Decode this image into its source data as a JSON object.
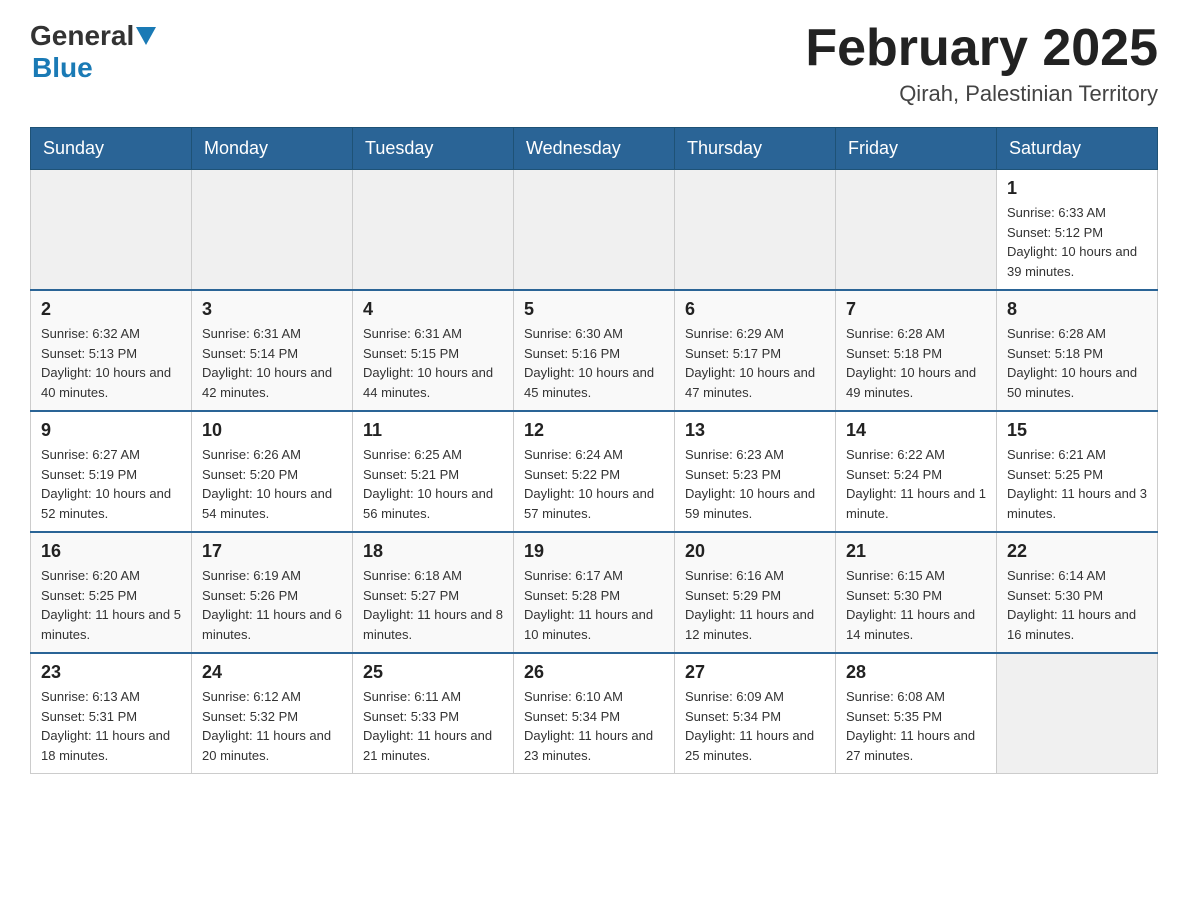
{
  "header": {
    "logo_general": "General",
    "logo_blue": "Blue",
    "month_title": "February 2025",
    "location": "Qirah, Palestinian Territory"
  },
  "days_of_week": [
    "Sunday",
    "Monday",
    "Tuesday",
    "Wednesday",
    "Thursday",
    "Friday",
    "Saturday"
  ],
  "weeks": [
    [
      {
        "date": "",
        "info": ""
      },
      {
        "date": "",
        "info": ""
      },
      {
        "date": "",
        "info": ""
      },
      {
        "date": "",
        "info": ""
      },
      {
        "date": "",
        "info": ""
      },
      {
        "date": "",
        "info": ""
      },
      {
        "date": "1",
        "info": "Sunrise: 6:33 AM\nSunset: 5:12 PM\nDaylight: 10 hours and 39 minutes."
      }
    ],
    [
      {
        "date": "2",
        "info": "Sunrise: 6:32 AM\nSunset: 5:13 PM\nDaylight: 10 hours and 40 minutes."
      },
      {
        "date": "3",
        "info": "Sunrise: 6:31 AM\nSunset: 5:14 PM\nDaylight: 10 hours and 42 minutes."
      },
      {
        "date": "4",
        "info": "Sunrise: 6:31 AM\nSunset: 5:15 PM\nDaylight: 10 hours and 44 minutes."
      },
      {
        "date": "5",
        "info": "Sunrise: 6:30 AM\nSunset: 5:16 PM\nDaylight: 10 hours and 45 minutes."
      },
      {
        "date": "6",
        "info": "Sunrise: 6:29 AM\nSunset: 5:17 PM\nDaylight: 10 hours and 47 minutes."
      },
      {
        "date": "7",
        "info": "Sunrise: 6:28 AM\nSunset: 5:18 PM\nDaylight: 10 hours and 49 minutes."
      },
      {
        "date": "8",
        "info": "Sunrise: 6:28 AM\nSunset: 5:18 PM\nDaylight: 10 hours and 50 minutes."
      }
    ],
    [
      {
        "date": "9",
        "info": "Sunrise: 6:27 AM\nSunset: 5:19 PM\nDaylight: 10 hours and 52 minutes."
      },
      {
        "date": "10",
        "info": "Sunrise: 6:26 AM\nSunset: 5:20 PM\nDaylight: 10 hours and 54 minutes."
      },
      {
        "date": "11",
        "info": "Sunrise: 6:25 AM\nSunset: 5:21 PM\nDaylight: 10 hours and 56 minutes."
      },
      {
        "date": "12",
        "info": "Sunrise: 6:24 AM\nSunset: 5:22 PM\nDaylight: 10 hours and 57 minutes."
      },
      {
        "date": "13",
        "info": "Sunrise: 6:23 AM\nSunset: 5:23 PM\nDaylight: 10 hours and 59 minutes."
      },
      {
        "date": "14",
        "info": "Sunrise: 6:22 AM\nSunset: 5:24 PM\nDaylight: 11 hours and 1 minute."
      },
      {
        "date": "15",
        "info": "Sunrise: 6:21 AM\nSunset: 5:25 PM\nDaylight: 11 hours and 3 minutes."
      }
    ],
    [
      {
        "date": "16",
        "info": "Sunrise: 6:20 AM\nSunset: 5:25 PM\nDaylight: 11 hours and 5 minutes."
      },
      {
        "date": "17",
        "info": "Sunrise: 6:19 AM\nSunset: 5:26 PM\nDaylight: 11 hours and 6 minutes."
      },
      {
        "date": "18",
        "info": "Sunrise: 6:18 AM\nSunset: 5:27 PM\nDaylight: 11 hours and 8 minutes."
      },
      {
        "date": "19",
        "info": "Sunrise: 6:17 AM\nSunset: 5:28 PM\nDaylight: 11 hours and 10 minutes."
      },
      {
        "date": "20",
        "info": "Sunrise: 6:16 AM\nSunset: 5:29 PM\nDaylight: 11 hours and 12 minutes."
      },
      {
        "date": "21",
        "info": "Sunrise: 6:15 AM\nSunset: 5:30 PM\nDaylight: 11 hours and 14 minutes."
      },
      {
        "date": "22",
        "info": "Sunrise: 6:14 AM\nSunset: 5:30 PM\nDaylight: 11 hours and 16 minutes."
      }
    ],
    [
      {
        "date": "23",
        "info": "Sunrise: 6:13 AM\nSunset: 5:31 PM\nDaylight: 11 hours and 18 minutes."
      },
      {
        "date": "24",
        "info": "Sunrise: 6:12 AM\nSunset: 5:32 PM\nDaylight: 11 hours and 20 minutes."
      },
      {
        "date": "25",
        "info": "Sunrise: 6:11 AM\nSunset: 5:33 PM\nDaylight: 11 hours and 21 minutes."
      },
      {
        "date": "26",
        "info": "Sunrise: 6:10 AM\nSunset: 5:34 PM\nDaylight: 11 hours and 23 minutes."
      },
      {
        "date": "27",
        "info": "Sunrise: 6:09 AM\nSunset: 5:34 PM\nDaylight: 11 hours and 25 minutes."
      },
      {
        "date": "28",
        "info": "Sunrise: 6:08 AM\nSunset: 5:35 PM\nDaylight: 11 hours and 27 minutes."
      },
      {
        "date": "",
        "info": ""
      }
    ]
  ]
}
